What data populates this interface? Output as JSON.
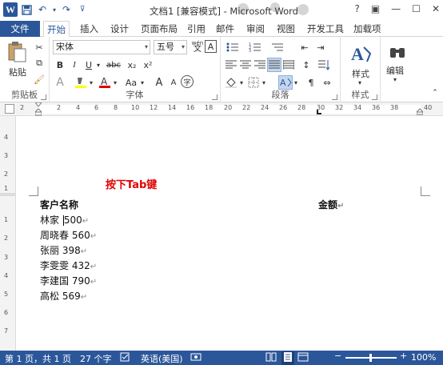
{
  "titlebar": {
    "title": "文档1 [兼容模式] - Microsoft Word",
    "logo": "W",
    "qat_icons": [
      "word-logo",
      "save-icon",
      "undo-icon",
      "redo-icon",
      "customize-icon"
    ],
    "window_controls": [
      "?",
      "▣",
      "—",
      "☐",
      "✕"
    ]
  },
  "tabs": {
    "file": "文件",
    "items": [
      "开始",
      "插入",
      "设计",
      "页面布局",
      "引用",
      "邮件",
      "审阅",
      "视图",
      "开发工具",
      "加载项"
    ]
  },
  "ribbon": {
    "clipboard": {
      "label": "剪贴板",
      "paste": "粘贴"
    },
    "font": {
      "label": "字体",
      "font_name": "宋体",
      "font_size": "五号",
      "wen_label": "wén",
      "a_box": "A",
      "bold": "B",
      "italic": "I",
      "underline": "U",
      "strike": "abc",
      "subscript": "x₂",
      "superscript": "x²",
      "case": "Aa",
      "grow": "A",
      "shrink": "A",
      "circle": "字"
    },
    "paragraph": {
      "label": "段落"
    },
    "styles": {
      "label": "样式",
      "button": "样式"
    },
    "editing": {
      "button": "编辑"
    }
  },
  "ruler": {
    "ticks": [
      "2",
      "2",
      "4",
      "6",
      "8",
      "10",
      "12",
      "14",
      "16",
      "18",
      "20",
      "22",
      "24",
      "26",
      "28",
      "30",
      "32",
      "34",
      "36",
      "38",
      "40"
    ]
  },
  "vruler": {
    "numbers": [
      "4",
      "3",
      "2",
      "1",
      "1",
      "2",
      "3",
      "4",
      "5",
      "6",
      "7"
    ]
  },
  "document": {
    "annotation": "按下Tab键",
    "header_left": "客户名称",
    "header_right": "金额",
    "rows": [
      {
        "name": "林家",
        "value": "500"
      },
      {
        "name": "周晓春",
        "value": "560"
      },
      {
        "name": "张丽",
        "value": "398"
      },
      {
        "name": "李雯雯",
        "value": "432"
      },
      {
        "name": "李建国",
        "value": "790"
      },
      {
        "name": "高松",
        "value": "569"
      }
    ],
    "para_mark": "↵"
  },
  "status": {
    "page": "第 1 页，共 1 页",
    "words": "27 个字",
    "language": "英语(美国)",
    "zoom": "100%"
  },
  "colors": {
    "accent": "#2b579a",
    "annotation": "#e00000"
  }
}
